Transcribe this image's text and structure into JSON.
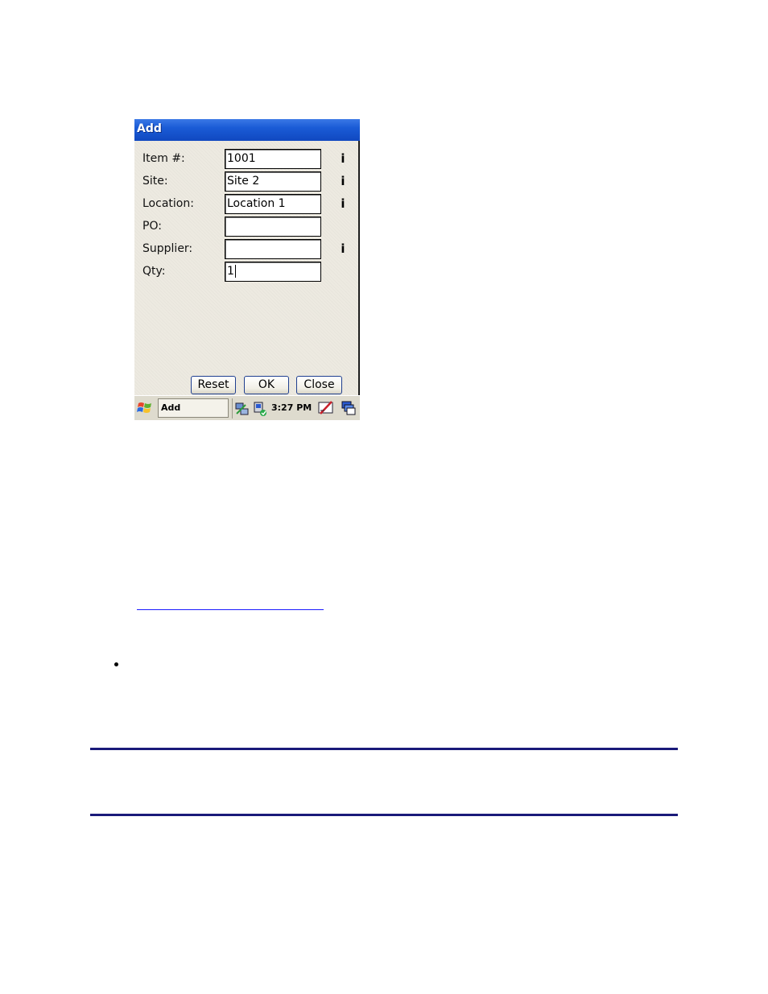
{
  "window": {
    "title": "Add"
  },
  "form": {
    "rows": [
      {
        "label": "Item #:",
        "value": "1001",
        "info": "i"
      },
      {
        "label": "Site:",
        "value": "Site 2",
        "info": "i"
      },
      {
        "label": "Location:",
        "value": "Location 1",
        "info": "i"
      },
      {
        "label": "PO:",
        "value": "",
        "info": ""
      },
      {
        "label": "Supplier:",
        "value": "",
        "info": "i"
      },
      {
        "label": "Qty:",
        "value": "1",
        "info": ""
      }
    ]
  },
  "buttons": {
    "reset": "Reset",
    "ok": "OK",
    "close": "Close"
  },
  "taskbar": {
    "active_task": "Add",
    "clock": "3:27 PM",
    "icons": [
      "windows-start-icon",
      "network-icon",
      "sync-icon",
      "input-panel-icon",
      "desktop-switch-icon"
    ]
  },
  "colors": {
    "titlebar": "#1a5bd6",
    "window_bg": "#edeae1",
    "taskbar": "#dedbce",
    "rule": "#1a1a7a",
    "link": "#1a1aff"
  }
}
